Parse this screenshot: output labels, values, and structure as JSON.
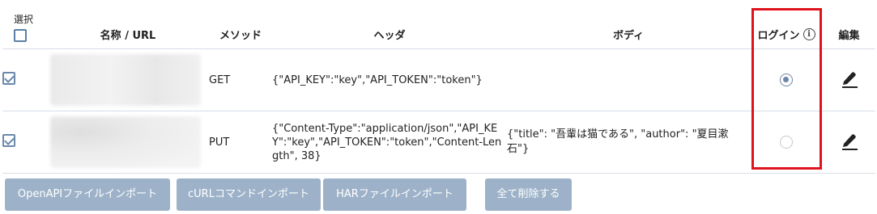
{
  "table": {
    "headers": {
      "select": "選択",
      "name_url": "名称 / URL",
      "method": "メソッド",
      "header": "ヘッダ",
      "body": "ボディ",
      "login": "ログイン",
      "edit": "編集"
    },
    "rows": [
      {
        "selected": true,
        "method": "GET",
        "header": "{\"API_KEY\":\"key\",\"API_TOKEN\":\"token\"}",
        "body": "",
        "login": true
      },
      {
        "selected": true,
        "method": "PUT",
        "header": "{\"Content-Type\":\"application/json\",\"API_KEY\":\"key\",\"API_TOKEN\":\"token\",\"Content-Length\", 38}",
        "body": "{\"title\": \"吾輩は猫である\", \"author\": \"夏目漱石\"}",
        "login": false
      }
    ]
  },
  "buttons": {
    "openapi_import": "OpenAPIファイルインポート",
    "curl_import": "cURLコマンドインポート",
    "har_import": "HARファイルインポート",
    "delete_all": "全て削除する"
  },
  "icons": {
    "info": "info-icon",
    "edit": "pencil-icon"
  },
  "colors": {
    "button_bg": "#9db2c9",
    "highlight_border": "#e0121b",
    "accent": "#6d87a8"
  }
}
